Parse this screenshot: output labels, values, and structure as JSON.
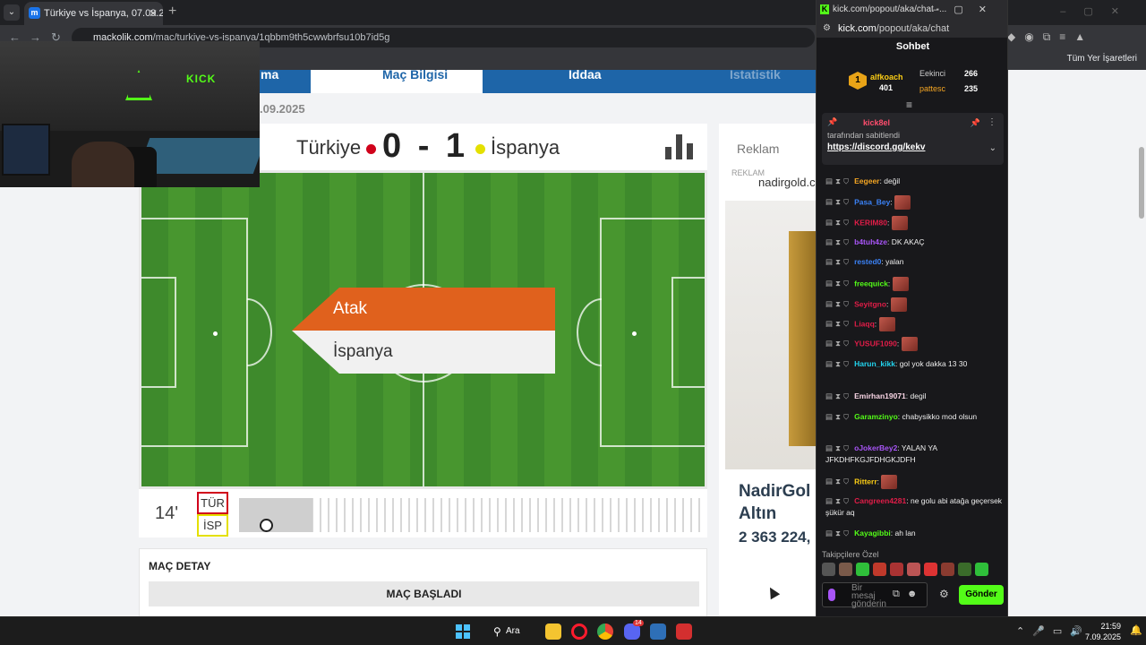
{
  "browser": {
    "tab_title": "Türkiye vs İspanya, 07.09.2025, ...",
    "url_domain": "mackolik.com",
    "url_path": "/mac/turkiye-vs-ispanya/1qbbm9th5cwwbrfsu10b7id5g",
    "bookmarks_all": "Tüm Yer İşaretleri"
  },
  "page": {
    "nav_partial_left": "ma",
    "nav_active": "Maç Bilgisi",
    "nav_iddaa": "İddaa",
    "nav_stats": "İstatistik",
    "date_fragment": ".09.2025",
    "home_team": "Türkiye",
    "away_team": "İspanya",
    "home_score": "0",
    "away_score": "1",
    "home_color": "#d0021b",
    "away_color": "#e4e000",
    "event_label": "Atak",
    "event_team": "İspanya",
    "minute": "14'",
    "home_abbr": "TÜR",
    "away_abbr": "İSP",
    "detail_title": "MAÇ DETAY",
    "detail_status": "MAÇ BAŞLADI"
  },
  "ad": {
    "title": "Reklam",
    "small": "REKLAM",
    "brand": "nadirgold.c",
    "name_line1": "NadirGol",
    "name_line2": "Altın",
    "price": "2 363 224,"
  },
  "webcam": {
    "sign": "KICK"
  },
  "chat_window": {
    "title": "kick.com/popout/aka/chat -...",
    "url_domain": "kick.com",
    "url_path": "/popout/aka/chat",
    "header": "Sohbet",
    "leaderboard": {
      "first_user": "alfkoach",
      "first_count": "401",
      "first_rank": "1",
      "second_user": "Eekinci",
      "second_count": "266",
      "third_user": "pattesc",
      "third_count": "235"
    },
    "pinned": {
      "user": "kick8el",
      "subtitle": "tarafından sabitlendi",
      "link": "https://discord.gg/kekv"
    },
    "messages": [
      {
        "user": "Eegeer",
        "color": "#f5a623",
        "text": "değil",
        "emote": false
      },
      {
        "user": "Pasa_Bey",
        "color": "#3b82f6",
        "text": "",
        "emote": true
      },
      {
        "user": "KERIM80",
        "color": "#e11d48",
        "text": "",
        "emote": true
      },
      {
        "user": "b4tuh4ze",
        "color": "#a855f7",
        "text": "DK AKAÇ",
        "emote": false
      },
      {
        "user": "rested0",
        "color": "#3b82f6",
        "text": "yalan",
        "emote": false
      },
      {
        "user": "freequick",
        "color": "#53fc18",
        "text": "",
        "emote": true
      },
      {
        "user": "Seyitgno",
        "color": "#e11d48",
        "text": "",
        "emote": true
      },
      {
        "user": "Liaqq",
        "color": "#e11d48",
        "text": "",
        "emote": true
      },
      {
        "user": "YUSUF1090",
        "color": "#e11d48",
        "text": "",
        "emote": true
      },
      {
        "user": "Harun_kikk",
        "color": "#22d3ee",
        "text": "gol yok dakka 13 30",
        "emote": false
      },
      {
        "user": "Emirhan19071",
        "color": "#f9d5e5",
        "text": "degil",
        "emote": false
      },
      {
        "user": "Garamzinyo",
        "color": "#53fc18",
        "text": "chabysikko mod olsun",
        "emote": false
      },
      {
        "user": "oJokerBey2",
        "color": "#a855f7",
        "text": "YALAN YA JFKDHFKGJFDHGKJDFH",
        "emote": false
      },
      {
        "user": "Ritterr",
        "color": "#facc15",
        "text": "",
        "emote": true
      },
      {
        "user": "Cangreen4281",
        "color": "#e11d48",
        "text": "ne golu abi atağa geçersek şükür aq",
        "emote": false
      },
      {
        "user": "Kayagibbi",
        "color": "#53fc18",
        "text": "ah lan",
        "emote": false
      }
    ],
    "followers_label": "Takipçilere Özel",
    "input_placeholder": "Bir mesaj gönderin",
    "send_label": "Gönder",
    "accent": "#53fc18"
  },
  "taskbar": {
    "search_label": "Ara",
    "time": "21:59",
    "date": "7.09.2025",
    "discord_badge": "14"
  }
}
